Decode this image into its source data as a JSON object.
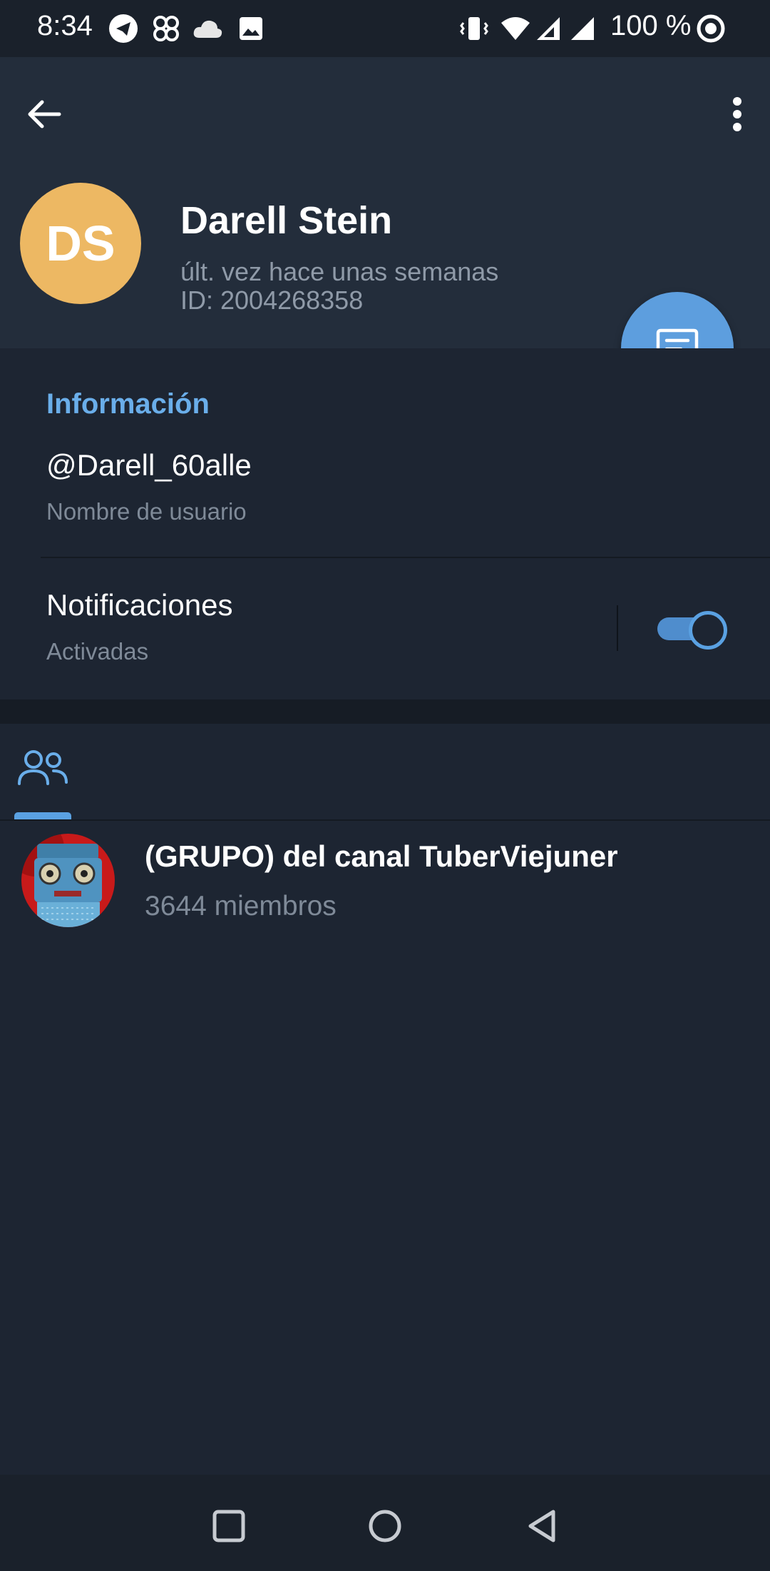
{
  "status_bar": {
    "time": "8:34",
    "battery": "100 %",
    "left_icons": [
      "telegram-icon",
      "pinwheel-icon",
      "cloud-icon",
      "image-icon"
    ],
    "right_icons": [
      "vibrate-icon",
      "wifi-icon",
      "signal-icon",
      "signal-icon",
      "focus-icon"
    ]
  },
  "header": {
    "avatar_initials": "DS",
    "avatar_color": "#edb863",
    "name": "Darell Stein",
    "status": "últ. vez hace unas semanas",
    "id_text": "ID: 2004268358"
  },
  "info": {
    "heading": "Información",
    "username": "@Darell_60alle",
    "username_caption": "Nombre de usuario",
    "notifications_label": "Notificaciones",
    "notifications_caption": "Activadas",
    "notifications_on": true
  },
  "tabs": {
    "active": "members-icon"
  },
  "groups": [
    {
      "title": "(GRUPO) del canal TuberViejuner",
      "members": "3644 miembros"
    }
  ],
  "colors": {
    "accent": "#5d9ede",
    "background": "#1d2532",
    "header": "#232d3b"
  }
}
